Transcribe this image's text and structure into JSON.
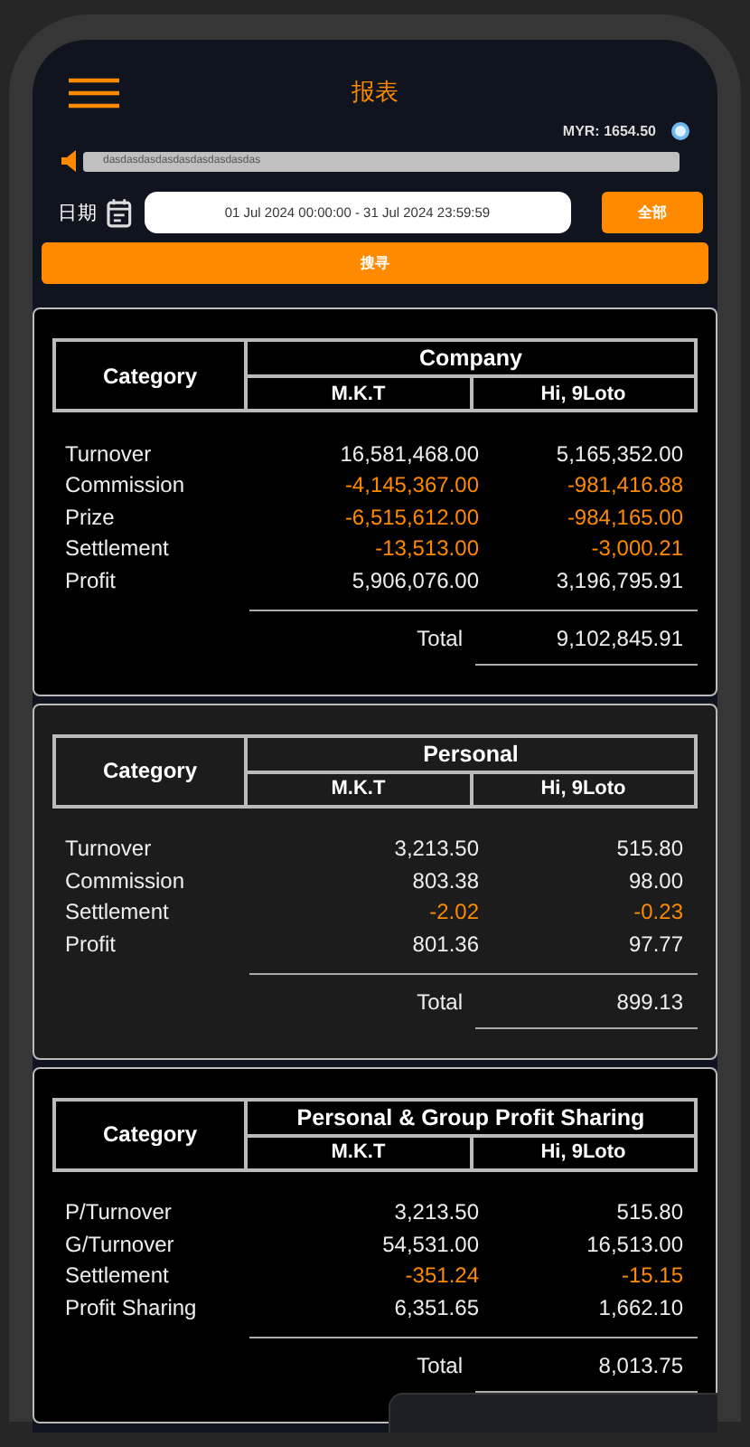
{
  "header": {
    "title": "报表"
  },
  "balance": "MYR: 1654.50",
  "marquee": "dasdasdasdasdasdasdasdasdas",
  "filters": {
    "date_label": "日期",
    "date_range": "01 Jul 2024 00:00:00  - 31 Jul 2024 23:59:59",
    "all_button": "全部",
    "search_button": "搜寻"
  },
  "reports": [
    {
      "title": "Company",
      "category_header": "Category",
      "columns": [
        "M.K.T",
        "Hi, 9Loto"
      ],
      "dark": true,
      "rows": [
        {
          "label": "Turnover",
          "values": [
            {
              "text": "16,581,468.00",
              "negative": false
            },
            {
              "text": "5,165,352.00",
              "negative": false
            }
          ]
        },
        {
          "label": "Commission",
          "values": [
            {
              "text": "-4,145,367.00",
              "negative": true
            },
            {
              "text": "-981,416.88",
              "negative": true
            }
          ]
        },
        {
          "label": "Prize",
          "values": [
            {
              "text": "-6,515,612.00",
              "negative": true
            },
            {
              "text": "-984,165.00",
              "negative": true
            }
          ]
        },
        {
          "label": "Settlement",
          "values": [
            {
              "text": "-13,513.00",
              "negative": true
            },
            {
              "text": "-3,000.21",
              "negative": true
            }
          ]
        },
        {
          "label": "Profit",
          "values": [
            {
              "text": "5,906,076.00",
              "negative": false
            },
            {
              "text": "3,196,795.91",
              "negative": false
            }
          ]
        }
      ],
      "total_label": "Total",
      "total": "9,102,845.91"
    },
    {
      "title": "Personal",
      "category_header": "Category",
      "columns": [
        "M.K.T",
        "Hi, 9Loto"
      ],
      "dark": false,
      "rows": [
        {
          "label": "Turnover",
          "values": [
            {
              "text": "3,213.50",
              "negative": false
            },
            {
              "text": "515.80",
              "negative": false
            }
          ]
        },
        {
          "label": "Commission",
          "values": [
            {
              "text": "803.38",
              "negative": false
            },
            {
              "text": "98.00",
              "negative": false
            }
          ]
        },
        {
          "label": "Settlement",
          "values": [
            {
              "text": "-2.02",
              "negative": true
            },
            {
              "text": "-0.23",
              "negative": true
            }
          ]
        },
        {
          "label": "Profit",
          "values": [
            {
              "text": "801.36",
              "negative": false
            },
            {
              "text": "97.77",
              "negative": false
            }
          ]
        }
      ],
      "total_label": "Total",
      "total": "899.13"
    },
    {
      "title": "Personal & Group Profit Sharing",
      "category_header": "Category",
      "columns": [
        "M.K.T",
        "Hi, 9Loto"
      ],
      "dark": true,
      "rows": [
        {
          "label": "P/Turnover",
          "values": [
            {
              "text": "3,213.50",
              "negative": false
            },
            {
              "text": "515.80",
              "negative": false
            }
          ]
        },
        {
          "label": "G/Turnover",
          "values": [
            {
              "text": "54,531.00",
              "negative": false
            },
            {
              "text": "16,513.00",
              "negative": false
            }
          ]
        },
        {
          "label": "Settlement",
          "values": [
            {
              "text": "-351.24",
              "negative": true
            },
            {
              "text": "-15.15",
              "negative": true
            }
          ]
        },
        {
          "label": "Profit Sharing",
          "values": [
            {
              "text": "6,351.65",
              "negative": false
            },
            {
              "text": "1,662.10",
              "negative": false
            }
          ]
        }
      ],
      "total_label": "Total",
      "total": "8,013.75"
    }
  ]
}
